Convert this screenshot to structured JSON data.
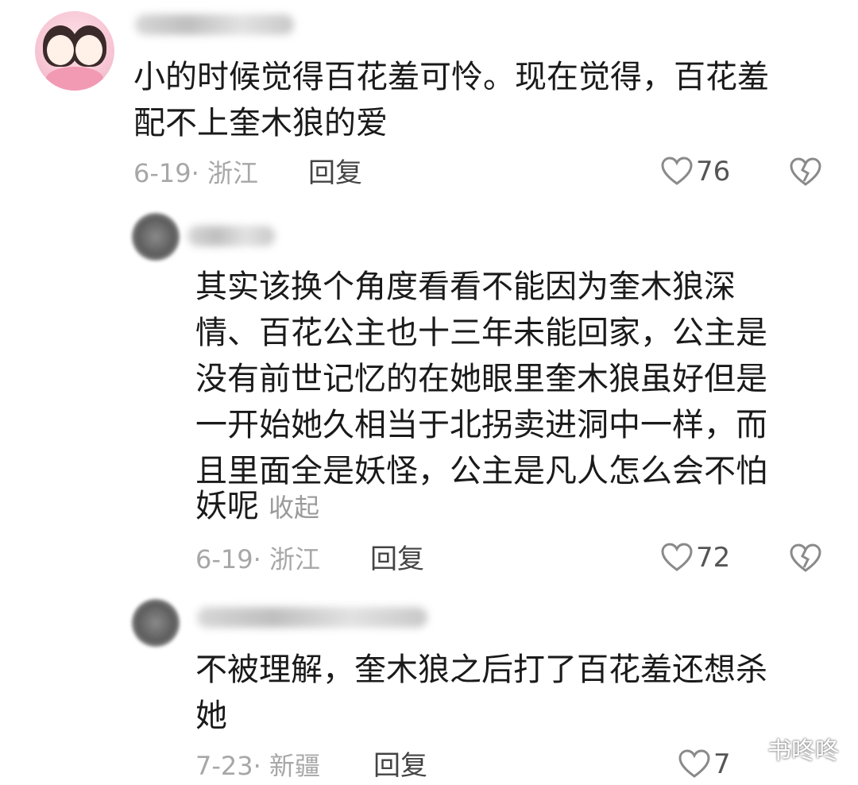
{
  "comments": [
    {
      "text_lines": [
        "小的时候觉得百花羞可怜。现在觉得，百花羞",
        "配不上奎木狼的爱"
      ],
      "date_location": "6-19· 浙江",
      "reply_label": "回复",
      "likes": "76"
    },
    {
      "text_lines": [
        "其实该换个角度看看不能因为奎木狼深",
        "情、百花公主也十三年未能回家，公主是",
        "没有前世记忆的在她眼里奎木狼虽好但是",
        "一开始她久相当于北拐卖进洞中一样，而",
        "且里面全是妖怪，公主是凡人怎么会不怕",
        "妖呢"
      ],
      "collapse_label": "收起",
      "date_location": "6-19· 浙江",
      "reply_label": "回复",
      "likes": "72"
    },
    {
      "text_lines": [
        "不被理解，奎木狼之后打了百花羞还想杀",
        "她"
      ],
      "date_location": "7-23· 新疆",
      "reply_label": "回复",
      "likes": "7"
    }
  ],
  "watermark": "书咚咚",
  "icons": {
    "like": "heart-outline-icon",
    "dislike": "broken-heart-icon",
    "watermark": "wechat-icon"
  },
  "colors": {
    "text": "#1a1a1a",
    "meta": "#a7a7a7",
    "icon": "#8a8a8a"
  }
}
